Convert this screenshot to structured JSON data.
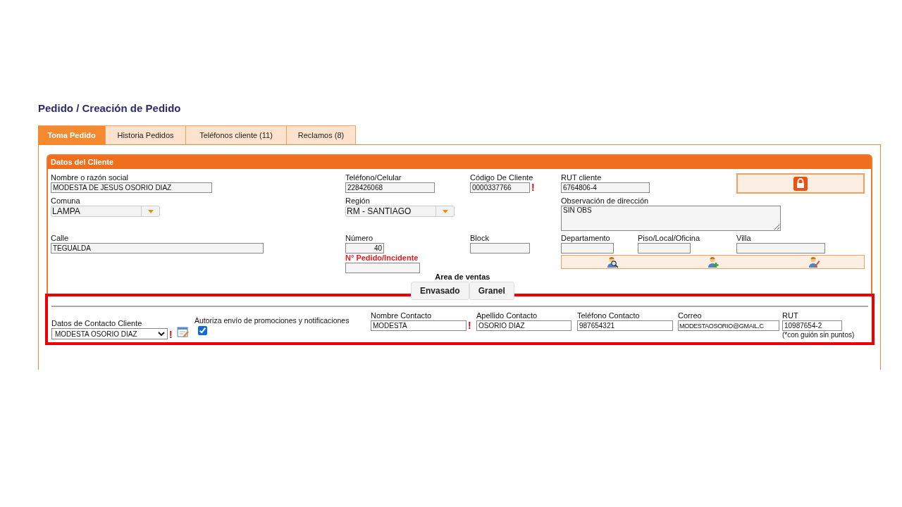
{
  "page_title": "Pedido / Creación de Pedido",
  "tabs": [
    {
      "label": "Toma Pedido",
      "selected": true
    },
    {
      "label": "Historia Pedidos",
      "selected": false
    },
    {
      "label": "Teléfonos cliente (11)",
      "selected": false
    },
    {
      "label": "Reclamos (8)",
      "selected": false
    }
  ],
  "client_panel": {
    "title": "Datos del Cliente",
    "nombre": {
      "label": "Nombre o razón social",
      "value": "MODESTA DE JESUS OSORIO DIAZ"
    },
    "telefono": {
      "label": "Teléfono/Celular",
      "value": "228426068"
    },
    "codigo": {
      "label": "Código De Cliente",
      "value": "0000337766",
      "alert": "!"
    },
    "rut": {
      "label": "RUT cliente",
      "value": "6764806-4"
    },
    "comuna": {
      "label": "Comuna",
      "value": "LAMPA"
    },
    "region": {
      "label": "Región",
      "value": "RM - SANTIAGO"
    },
    "observacion": {
      "label": "Observación de dirección",
      "value": "SIN OBS"
    },
    "calle": {
      "label": "Calle",
      "value": "TEGUALDA"
    },
    "numero": {
      "label": "Número",
      "value": "40"
    },
    "block": {
      "label": "Block"
    },
    "departamento": {
      "label": "Departamento"
    },
    "piso": {
      "label": "Piso/Local/Oficina"
    },
    "villa": {
      "label": "Villa"
    },
    "pedido_incidente": {
      "label": "N° Pedido/Incidente"
    },
    "area_ventas": {
      "label": "Area de ventas",
      "buttons": [
        "Envasado",
        "Granel"
      ]
    }
  },
  "contact": {
    "selector": {
      "label": "Datos de Contacto Cliente",
      "value": "MODESTA OSORIO DIAZ",
      "alert": "!"
    },
    "autoriza": {
      "label": "Autoriza envío de promociones y notificaciones",
      "checked": true
    },
    "nombre": {
      "label": "Nombre Contacto",
      "value": "MODESTA",
      "alert": "!"
    },
    "apellido": {
      "label": "Apellido Contacto",
      "value": "OSORIO DIAZ"
    },
    "telefono": {
      "label": "Teléfono Contacto",
      "value": "987654321"
    },
    "correo": {
      "label": "Correo",
      "value": "MODESTAOSORIO@GMAIL.C"
    },
    "rut": {
      "label": "RUT",
      "value": "10987654-2",
      "hint": "(*con guión sin puntos)"
    }
  }
}
